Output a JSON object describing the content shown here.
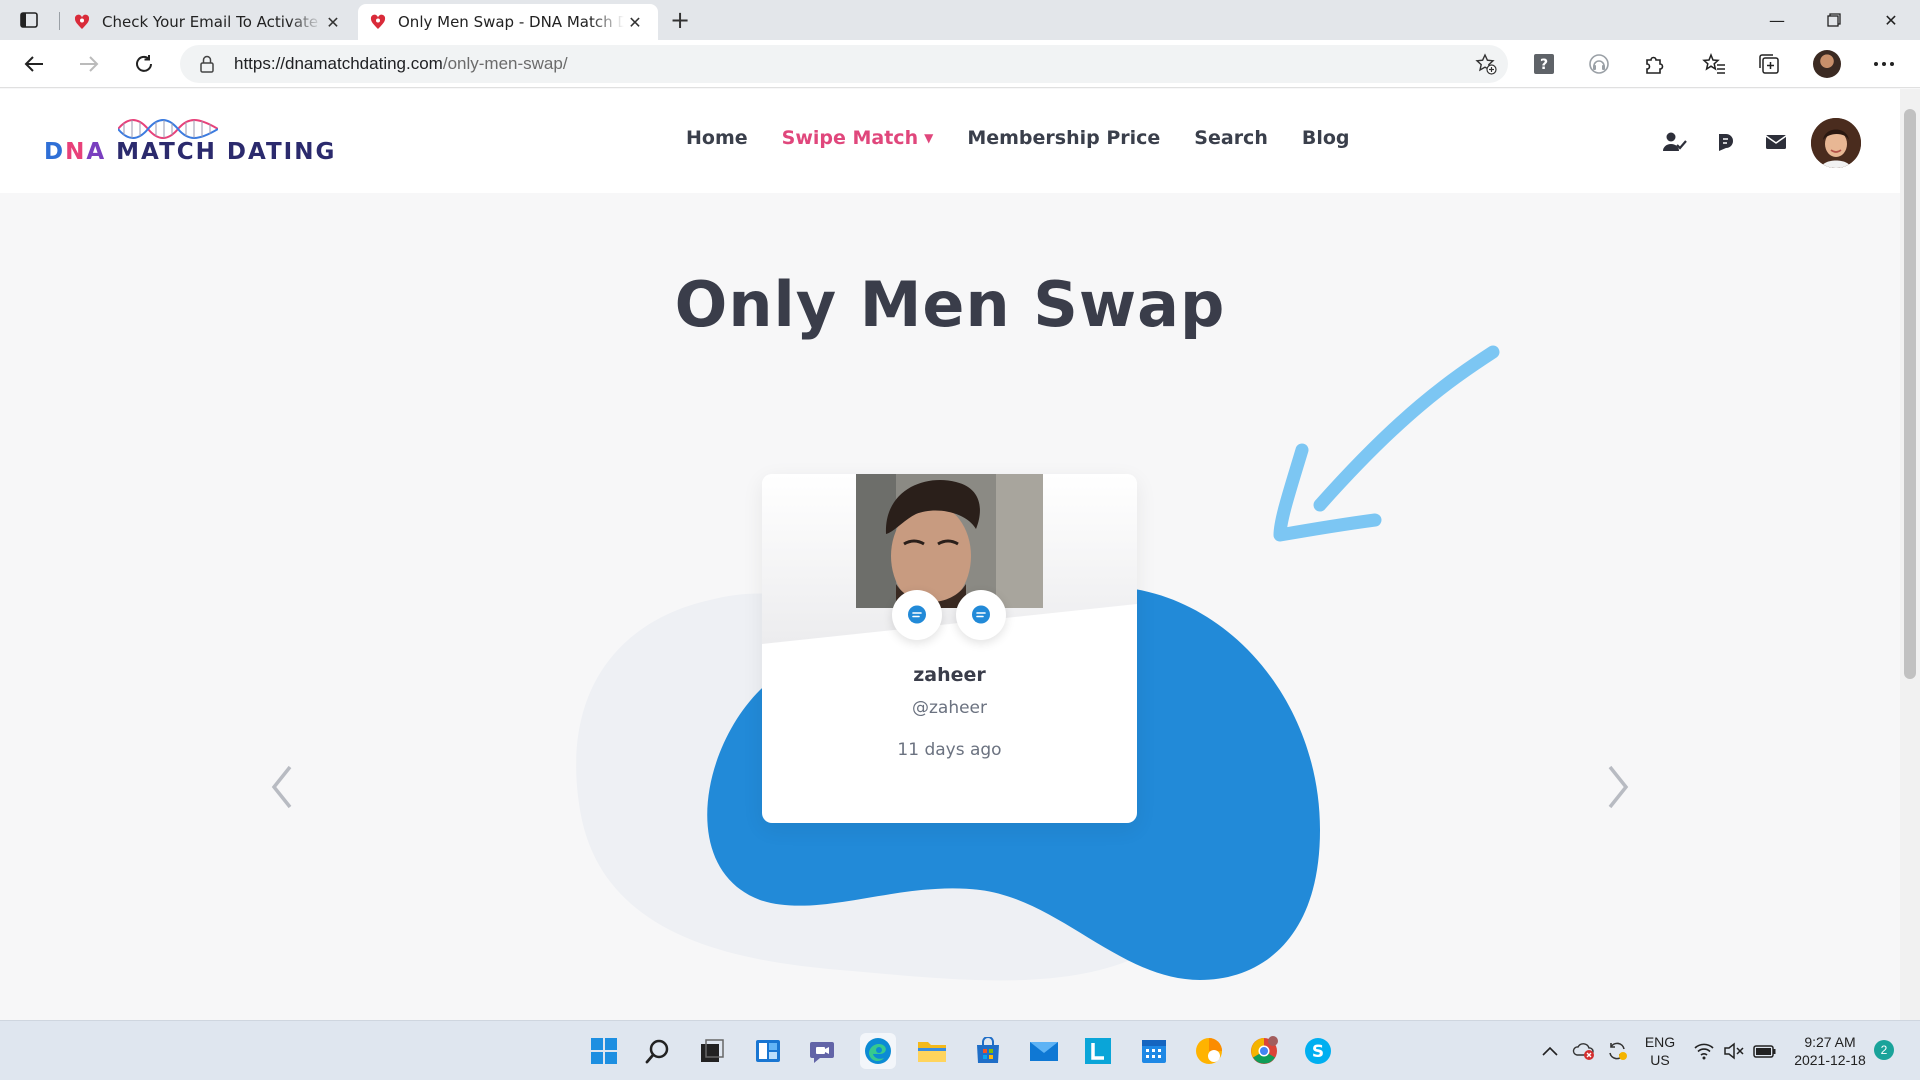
{
  "browser": {
    "tabs": [
      {
        "title": "Check Your Email To Activate Your Account",
        "active": false
      },
      {
        "title": "Only Men Swap - DNA Match Dating",
        "active": true
      }
    ],
    "address": {
      "url_host": "https://dnamatchdating.com",
      "url_path": "/only-men-swap/"
    },
    "icons": [
      "tab-actions-icon",
      "back-icon",
      "forward-icon",
      "refresh-icon",
      "lock-icon",
      "add-favorite-icon",
      "extension-question-icon",
      "read-aloud-icon",
      "extensions-icon",
      "favorites-icon",
      "collections-icon",
      "profile-avatar",
      "more-icon"
    ]
  },
  "site": {
    "logo_text": {
      "d": "D",
      "n": "N",
      "a": "A",
      "rest": " MATCH DATING"
    },
    "nav": [
      {
        "label": "Home",
        "active": false
      },
      {
        "label": "Swipe Match",
        "active": true,
        "has_dropdown": true
      },
      {
        "label": "Membership Price",
        "active": false
      },
      {
        "label": "Search",
        "active": false
      },
      {
        "label": "Blog",
        "active": false
      }
    ],
    "header_icons": [
      "user-check-icon",
      "activity-icon",
      "mail-icon",
      "user-avatar"
    ],
    "accent_color": "#e0477c",
    "blob_color": "#228ad8"
  },
  "page": {
    "title": "Only Men Swap",
    "card": {
      "name": "zaheer",
      "handle": "@zaheer",
      "time": "11 days ago",
      "buttons": [
        "chat-bubble-icon",
        "chat-bubble-icon"
      ]
    },
    "carousel": {
      "prev": "chevron-left-icon",
      "next": "chevron-right-icon"
    }
  },
  "taskbar": {
    "apps": [
      "start-icon",
      "search-icon",
      "task-view-icon",
      "widgets-icon",
      "teams-chat-icon",
      "edge-icon",
      "file-explorer-icon",
      "store-icon",
      "mail-icon",
      "l-app-icon",
      "calendar-icon",
      "paint-icon",
      "chrome-icon",
      "skype-icon"
    ],
    "language": {
      "line1": "ENG",
      "line2": "US"
    },
    "clock": {
      "time": "9:27 AM",
      "date": "2021-12-18"
    },
    "notifications": "2"
  }
}
